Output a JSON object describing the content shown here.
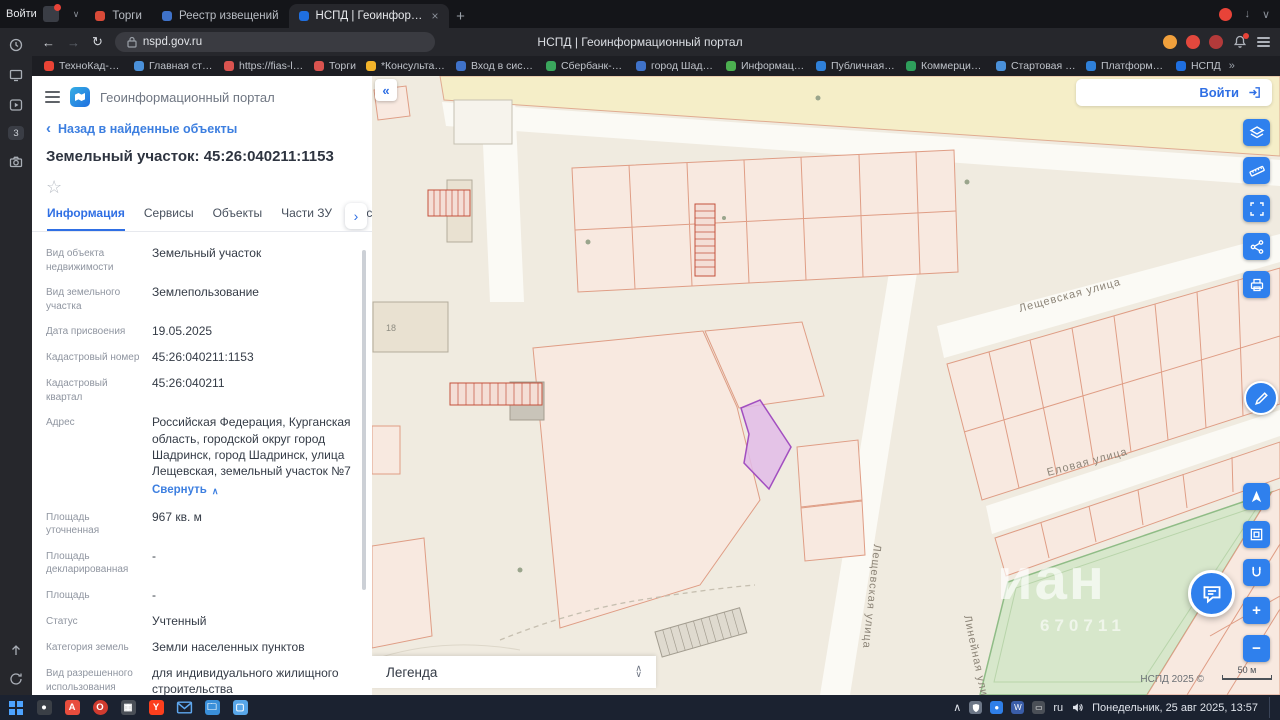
{
  "colors": {
    "accent_blue": "#2f6fe4",
    "tool_blue": "#2f80ed",
    "selected_parcel": "#a24fc0",
    "parcel_line": "#df9d85"
  },
  "icons": {
    "back": "‹",
    "more": "›",
    "collapse_panel": "«",
    "up": "∧",
    "down": "∨",
    "star": "☆",
    "close": "×",
    "new_tab": "+",
    "plus": "+",
    "minus": "−",
    "nav_back": "←",
    "nav_forward": "→",
    "reload": "↻",
    "overflow": "»",
    "tab_chevron": "∨"
  },
  "chrome": {
    "pinned_tab": "Войти",
    "tabs": [
      {
        "title": "Торги",
        "color": "#d94a38"
      },
      {
        "title": "Реестр извещений",
        "color": "#3f72c9"
      },
      {
        "title": "НСПД | Геоинформац...",
        "color": "#1f6fe0"
      }
    ],
    "url": "nspd.gov.ru",
    "page_title": "НСПД | Геоинформационный портал",
    "bookmarks": [
      {
        "label": "ТехноКад-Муниц",
        "color": "#ea4335"
      },
      {
        "label": "Главная страниц",
        "color": "#4a90d9"
      },
      {
        "label": "https://fias-lk.nal",
        "color": "#d9534f"
      },
      {
        "label": "Торги",
        "color": "#d9534f"
      },
      {
        "label": "*КонсультантПлю",
        "color": "#f2b32a"
      },
      {
        "label": "Вход в систему З",
        "color": "#3f72c9"
      },
      {
        "label": "Сбербанк-АСТ -",
        "color": "#3aa65c"
      },
      {
        "label": "город Шадринск",
        "color": "#3f72c9"
      },
      {
        "label": "Информация о р",
        "color": "#4caf50"
      },
      {
        "label": "Публичная кадас",
        "color": "#2f80d9"
      },
      {
        "label": "Коммерция МО.",
        "color": "#2e9e5b"
      },
      {
        "label": "Стартовая стран",
        "color": "#4a90d9"
      },
      {
        "label": "Платформа госу",
        "color": "#2f80d9"
      },
      {
        "label": "НСПД",
        "color": "#1f6fe0"
      }
    ]
  },
  "strip": {
    "badge_count": "3"
  },
  "panel": {
    "app_title": "Геоинформационный портал",
    "back_link": "Назад в найденные объекты",
    "title": "Земельный участок: 45:26:040211:1153",
    "tabs": [
      {
        "label": "Информация"
      },
      {
        "label": "Сервисы"
      },
      {
        "label": "Объекты"
      },
      {
        "label": "Части ЗУ"
      },
      {
        "label": "Соста"
      }
    ],
    "fields": [
      {
        "label": "Вид объекта недвижимости",
        "value": "Земельный участок"
      },
      {
        "label": "Вид земельного участка",
        "value": "Землепользование"
      },
      {
        "label": "Дата присвоения",
        "value": "19.05.2025"
      },
      {
        "label": "Кадастровый номер",
        "value": "45:26:040211:1153"
      },
      {
        "label": "Кадастровый квартал",
        "value": "45:26:040211"
      },
      {
        "label": "Адрес",
        "value": "Российская Федерация, Курганская область, городской округ город Шадринск, город Шадринск, улица Лещевская, земельный участок №7",
        "link": "Свернуть"
      },
      {
        "label": "Площадь уточненная",
        "value": "967 кв. м"
      },
      {
        "label": "Площадь декларированная",
        "value": "-"
      },
      {
        "label": "Площадь",
        "value": "-"
      },
      {
        "label": "Статус",
        "value": "Учтенный"
      },
      {
        "label": "Категория земель",
        "value": "Земли населенных пунктов"
      },
      {
        "label": "Вид разрешенного использования",
        "value": "для индивидуального жилищного строительства"
      }
    ]
  },
  "map": {
    "login_label": "Войти",
    "legend_label": "Легенда",
    "attribution": "НСПД 2025 ©",
    "scale_label": "50 м",
    "building_number": "18",
    "watermark_line1": "иан",
    "watermark_line2": "670711",
    "streets": {
      "leshchevskaya_top": "Лещевская улица",
      "elovaya": "Еловая улица",
      "leshchevskaya_vertical": "Лещевская улица",
      "bottom": "Линейная улица"
    }
  },
  "taskbar": {
    "language": "ru",
    "datetime": "Понедельник, 25 авг 2025, 13:57"
  }
}
